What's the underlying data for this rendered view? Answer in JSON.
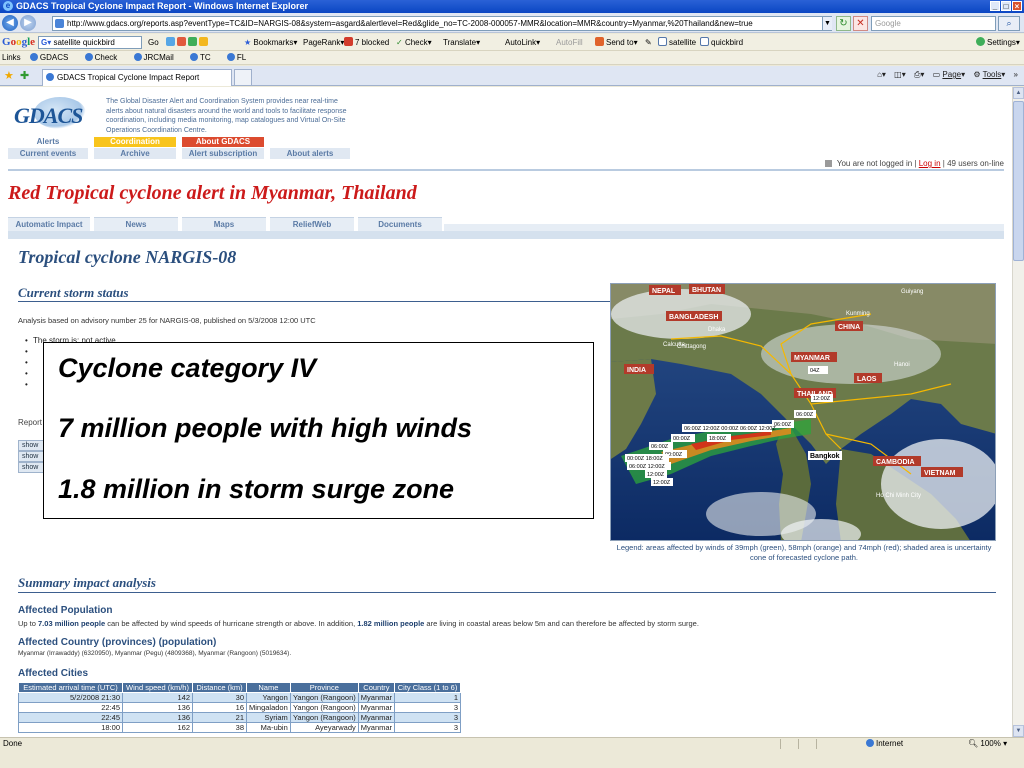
{
  "window": {
    "title": "GDACS Tropical Cyclone Impact Report - Windows Internet Explorer",
    "url": "http://www.gdacs.org/reports.asp?eventType=TC&ID=NARGIS-08&system=asgard&alertlevel=Red&glide_no=TC-2008-000057-MMR&location=MMR&country=Myanmar,%20Thailand&new=true",
    "search_placeholder": "Google"
  },
  "google_toolbar": {
    "search_value": "satellite quickbird",
    "items": [
      "Go",
      "Bookmarks",
      "PageRank",
      "7 blocked",
      "Check",
      "Translate",
      "AutoLink",
      "AutoFill",
      "Send to",
      "satellite",
      "quickbird"
    ],
    "settings": "Settings"
  },
  "links_bar": [
    "Links",
    "GDACS",
    "Check",
    "JRCMail",
    "TC",
    "FL"
  ],
  "tab": {
    "label": "GDACS Tropical Cyclone Impact Report"
  },
  "command_bar": [
    "Page",
    "Tools"
  ],
  "site": {
    "logo": "GDACS",
    "intro": "The Global Disaster Alert and Coordination System provides near real-time alerts about natural disasters around the world and tools to facilitate response coordination, including media monitoring, map catalogues and Virtual On-Site Operations Coordination Centre.",
    "nav": [
      {
        "top": "Alerts",
        "bottom": "Current events"
      },
      {
        "top": "Coordination",
        "bottom": "Archive"
      },
      {
        "top": "About GDACS",
        "bottom": "Alert subscription"
      },
      {
        "top": "",
        "bottom": "About alerts"
      }
    ],
    "login_prefix": "You are not logged in |",
    "login_link": "Log in",
    "login_suffix": "| 49 users on-line"
  },
  "page": {
    "alert_title": "Red Tropical cyclone alert in Myanmar, Thailand",
    "tabs": [
      "Automatic Impact",
      "News",
      "Maps",
      "ReliefWeb",
      "Documents"
    ],
    "event_title": "Tropical cyclone NARGIS-08",
    "current_status_title": "Current storm status",
    "advisory": "Analysis based on advisory number 25 for NARGIS-08, published on 5/3/2008 12:00 UTC",
    "bullet_first": "The storm is: not active",
    "report_label": "Report",
    "show_label": "show",
    "map_labels": {
      "nepal": "NEPAL",
      "bhutan": "BHUTAN",
      "bangladesh": "BANGLADESH",
      "china": "CHINA",
      "india": "INDIA",
      "myanmar": "MYANMAR",
      "laos": "LAOS",
      "thailand": "THAILAND",
      "cambodia": "CAMBODIA",
      "vietnam": "VIETNAM",
      "bangkok": "Bangkok",
      "dhaka": "Dhaka",
      "calcutta": "Calcutta",
      "chittagong": "Chittagong",
      "kunming": "Kunming",
      "guiyang": "Guiyang",
      "hanoi": "Hanoi",
      "hcm": "Ho Chi Minh City"
    },
    "map_legend": "Legend: areas affected by winds of 39mph (green), 58mph (orange) and 74mph (red); shaded area is uncertainty cone of forecasted cyclone path.",
    "overlay_lines": [
      "Cyclone category IV",
      "7 million people with high winds",
      "1.8 million in storm surge zone"
    ],
    "summary_title": "Summary impact analysis",
    "affected_population_title": "Affected Population",
    "affected_population_text_1": "Up to ",
    "affected_population_bold_1": "7.03 million people",
    "affected_population_text_2": " can be affected by wind speeds of hurricane strength or above. In addition, ",
    "affected_population_bold_2": "1.82 million people",
    "affected_population_text_3": " are living in coastal areas below 5m and can therefore be affected by storm surge.",
    "affected_country_title": "Affected Country (provinces) (population)",
    "affected_country_text": "Myanmar (Irrawaddy) (6320950), Myanmar (Pegu) (4809368), Myanmar (Rangoon) (5019634).",
    "affected_cities_title": "Affected Cities",
    "cities_headers": [
      "Estimated arrival time (UTC)",
      "Wind speed (km/h)",
      "Distance (km)",
      "Name",
      "Province",
      "Country",
      "City Class (1 to 6)"
    ],
    "cities_rows": [
      [
        "5/2/2008 21:30",
        "142",
        "30",
        "Yangon",
        "Yangon (Rangoon)",
        "Myanmar",
        "1"
      ],
      [
        "22:45",
        "136",
        "16",
        "Mingaladon",
        "Yangon (Rangoon)",
        "Myanmar",
        "3"
      ],
      [
        "22:45",
        "136",
        "21",
        "Syriam",
        "Yangon (Rangoon)",
        "Myanmar",
        "3"
      ],
      [
        "18:00",
        "162",
        "38",
        "Ma-ubin",
        "Ayeyarwady",
        "Myanmar",
        "3"
      ]
    ]
  },
  "status": {
    "left": "Done",
    "zone": "Internet",
    "zoom": "100%"
  }
}
